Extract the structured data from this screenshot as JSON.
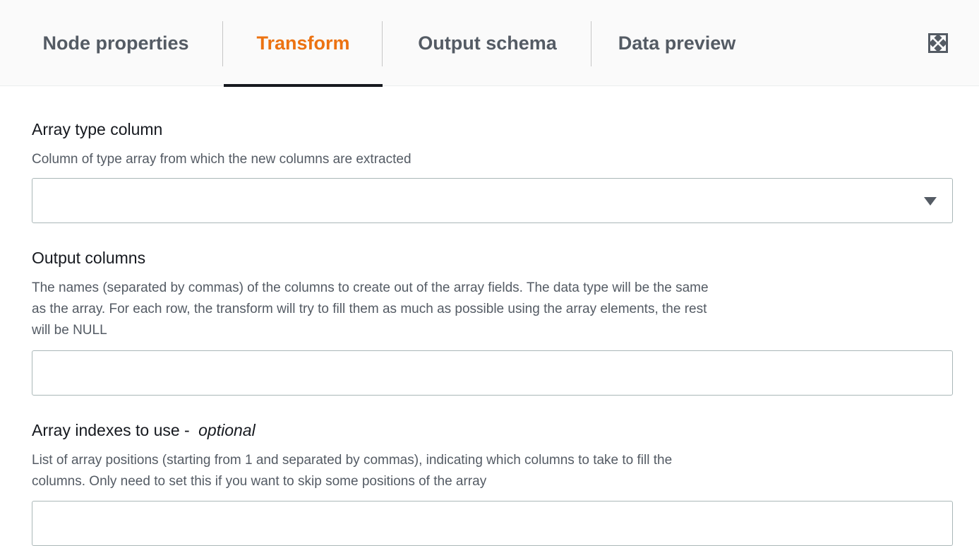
{
  "tabs": [
    {
      "label": "Node properties",
      "active": false
    },
    {
      "label": "Transform",
      "active": true
    },
    {
      "label": "Output schema",
      "active": false
    },
    {
      "label": "Data preview",
      "active": false
    }
  ],
  "header": {
    "expand_icon": "expand-arrows-icon"
  },
  "colors": {
    "active_tab": "#ec7211",
    "tab_text": "#545b64",
    "description": "#545b64"
  },
  "fields": {
    "array_type_column": {
      "label": "Array type column",
      "description": "Column of type array from which the new columns are extracted",
      "selected_value": "",
      "icon": "caret-down-icon"
    },
    "output_columns": {
      "label": "Output columns",
      "description_lines": [
        "The names (separated by commas) of the columns to create out of the array fields. The data type will be the same",
        "as the array. For each row, the transform will try to fill them as much as possible using the array elements, the rest",
        "will be NULL"
      ],
      "value": ""
    },
    "array_indexes": {
      "label": "Array indexes to use -",
      "label_optional": "optional",
      "description_lines": [
        "List of array positions (starting from 1 and separated by commas), indicating which columns to take to fill the",
        "columns. Only need to set this if you want to skip some positions of the array"
      ],
      "value": ""
    }
  }
}
